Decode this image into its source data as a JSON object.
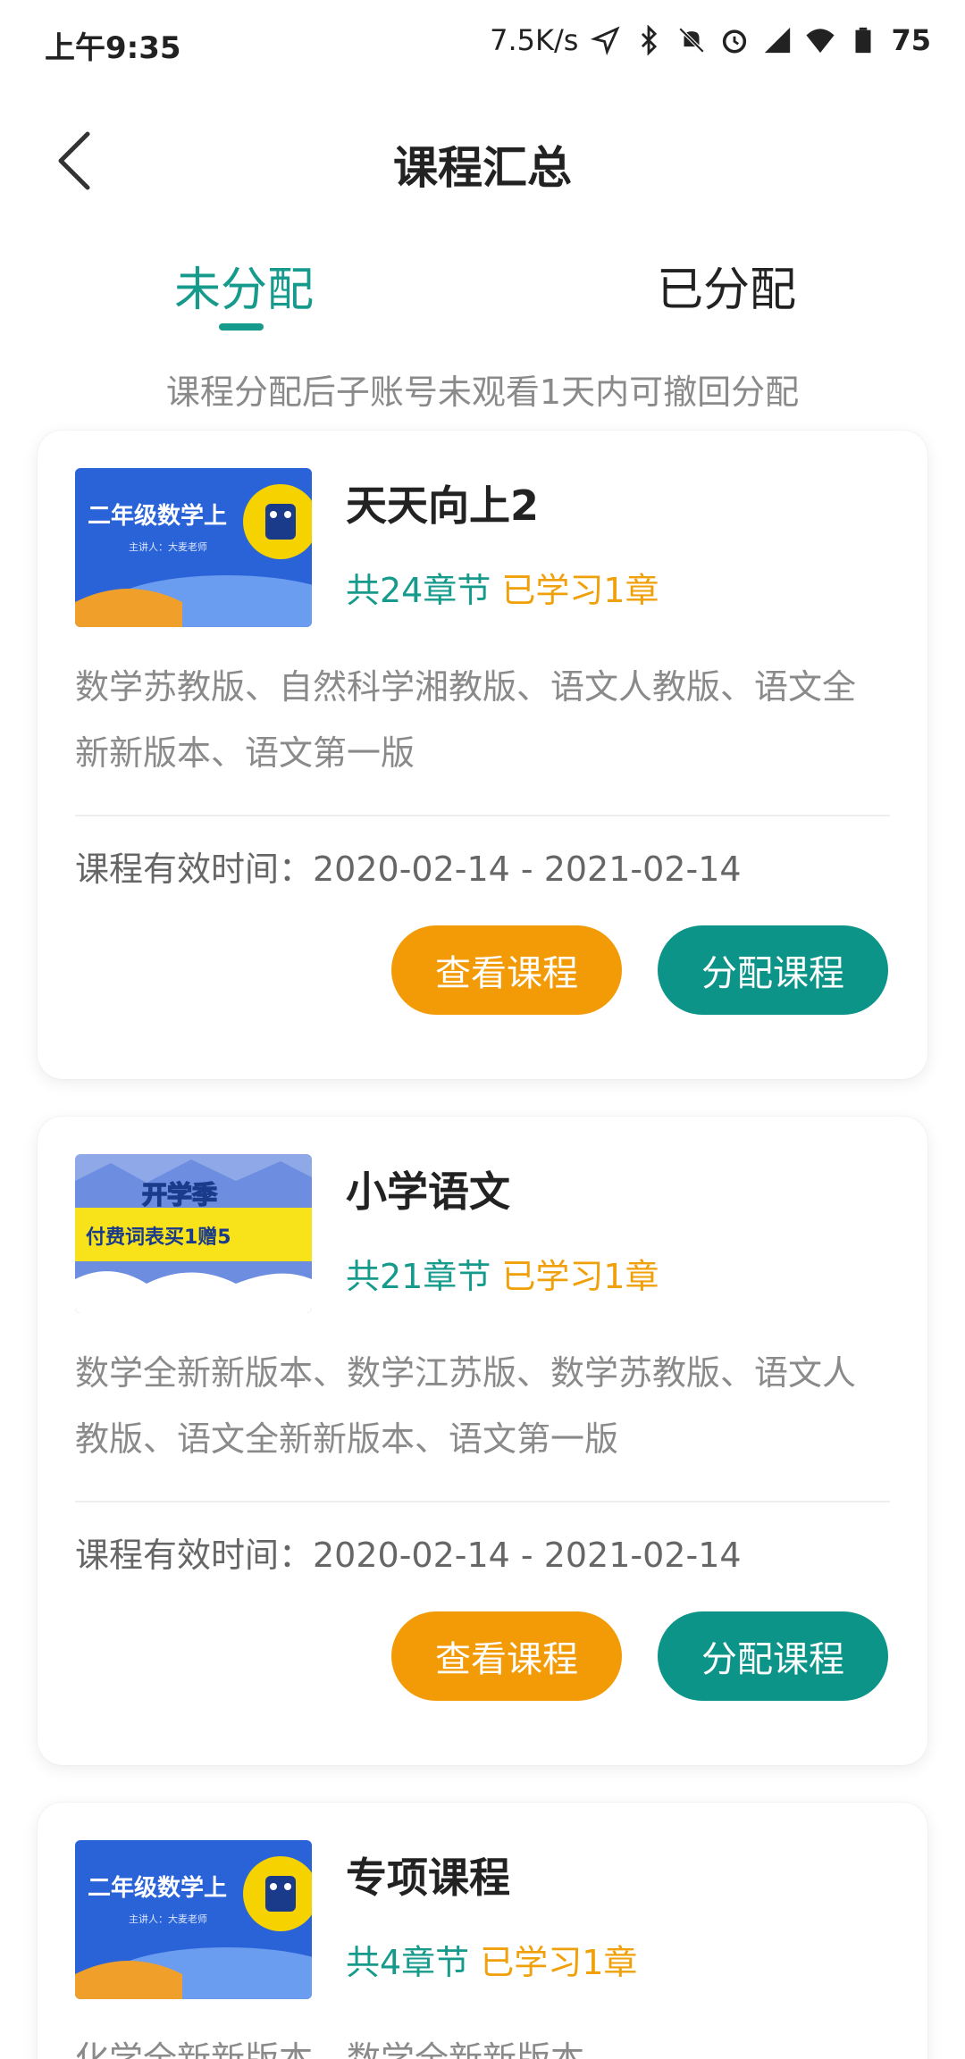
{
  "status": {
    "time": "上午9:35",
    "speed": "7.5K/s",
    "battery": "75",
    "icons": [
      "location-icon",
      "bluetooth-icon",
      "mute-icon",
      "alarm-icon",
      "signal-icon",
      "wifi-icon",
      "battery-icon"
    ]
  },
  "nav": {
    "title": "课程汇总",
    "back_icon": "chevron-left-icon"
  },
  "tabs": [
    {
      "label": "未分配",
      "active": true
    },
    {
      "label": "已分配",
      "active": false
    }
  ],
  "tip": "课程分配后子账号未观看1天内可撤回分配",
  "colors": {
    "accent": "#169a8c",
    "orange": "#f29b07",
    "teal_button": "#0d9488"
  },
  "courses": [
    {
      "title": "天天向上2",
      "chapters": "共24章节",
      "learned": "已学习1章",
      "desc": "数学苏教版、自然科学湘教版、语文人教版、语文全新新版本、语文第一版",
      "valid": "课程有效时间：2020-02-14 - 2021-02-14",
      "thumb_text": "二年级数学上",
      "thumb_sub": "主讲人：大麦老师",
      "view_label": "查看课程",
      "assign_label": "分配课程"
    },
    {
      "title": "小学语文",
      "chapters": "共21章节",
      "learned": "已学习1章",
      "desc": "数学全新新版本、数学江苏版、数学苏教版、语文人教版、语文全新新版本、语文第一版",
      "valid": "课程有效时间：2020-02-14 - 2021-02-14",
      "thumb_text": "开学季",
      "thumb_sub": "付费词表买1赠5",
      "view_label": "查看课程",
      "assign_label": "分配课程"
    },
    {
      "title": "专项课程",
      "chapters": "共4章节",
      "learned": "已学习1章",
      "desc": "化学全新新版本、数学全新新版本",
      "thumb_text": "二年级数学上",
      "thumb_sub": "主讲人：大麦老师"
    }
  ]
}
